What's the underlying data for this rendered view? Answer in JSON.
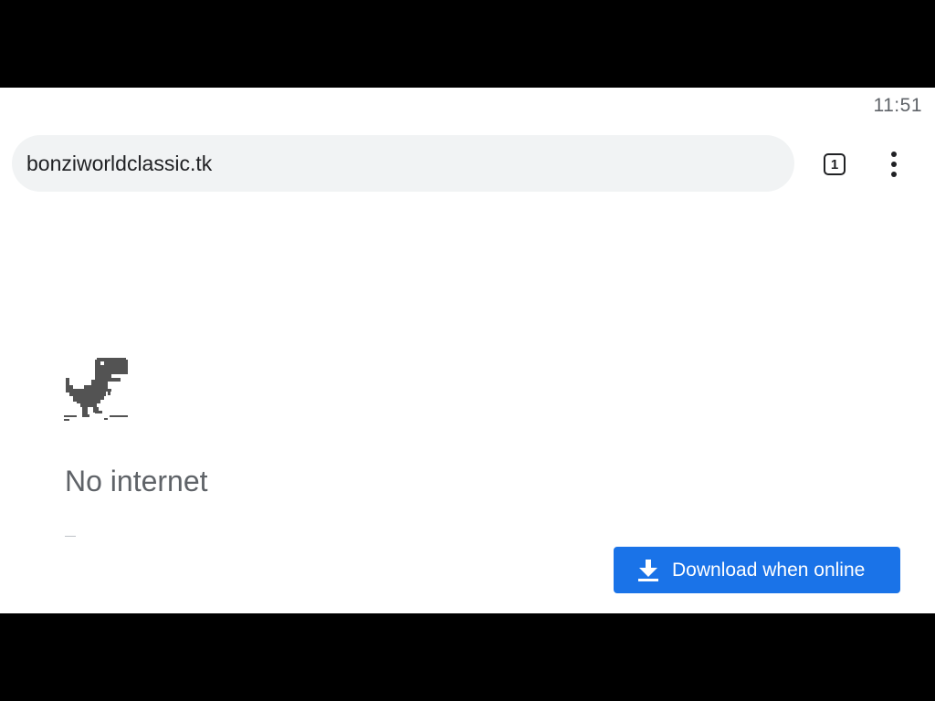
{
  "status_bar": {
    "time": "11:51"
  },
  "toolbar": {
    "url": "bonziworldclassic.tk",
    "tab_count": "1"
  },
  "page": {
    "heading": "No internet",
    "download_button_label": "Download when online"
  },
  "icons": {
    "tab_switcher": "tab-switcher-icon",
    "menu": "more-vert-icon",
    "dino": "offline-dino-icon",
    "download": "download-icon"
  },
  "colors": {
    "url_bar_bg": "#f1f3f4",
    "text_dark": "#202124",
    "text_grey": "#5f6368",
    "button_blue": "#1a73e8",
    "dino": "#535353"
  }
}
